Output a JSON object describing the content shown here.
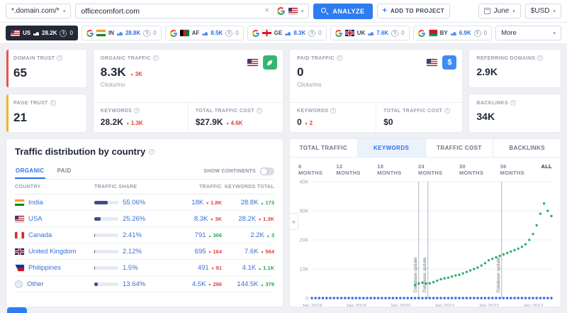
{
  "icons": {
    "chevron": "▾",
    "close": "×",
    "collapse": "«",
    "plus": "+",
    "dollar": "$"
  },
  "topbar": {
    "scope_select": "*.domain.com/*",
    "search_value": "officecomfort.com",
    "analyze_label": "ANALYZE",
    "add_to_project_label": "ADD TO PROJECT",
    "month_select": "June",
    "currency_select": "$USD"
  },
  "country_bar": {
    "more_label": "More",
    "tabs": [
      {
        "code": "US",
        "flag": "us",
        "traffic": "28.2K",
        "paid": "0",
        "active": true
      },
      {
        "code": "IN",
        "flag": "in",
        "traffic": "28.8K",
        "paid": "0",
        "active": false
      },
      {
        "code": "AF",
        "flag": "af",
        "traffic": "8.5K",
        "paid": "0",
        "active": false
      },
      {
        "code": "GE",
        "flag": "ge",
        "traffic": "8.3K",
        "paid": "0",
        "active": false
      },
      {
        "code": "UK",
        "flag": "gb",
        "traffic": "7.6K",
        "paid": "0",
        "active": false
      },
      {
        "code": "BY",
        "flag": "by",
        "traffic": "6.9K",
        "paid": "0",
        "active": false
      }
    ]
  },
  "summary": {
    "domain_trust": {
      "label": "DOMAIN TRUST",
      "value": "65"
    },
    "page_trust": {
      "label": "PAGE TRUST",
      "value": "21"
    },
    "organic": {
      "label": "ORGANIC TRAFFIC",
      "value": "8.3K",
      "delta": "3K",
      "delta_dir": "down",
      "unit": "Clicks/mo",
      "keywords_label": "KEYWORDS",
      "keywords_value": "28.2K",
      "keywords_delta": "1.3K",
      "keywords_delta_dir": "down",
      "cost_label": "TOTAL TRAFFIC COST",
      "cost_value": "$27.9K",
      "cost_delta": "4.6K",
      "cost_delta_dir": "down"
    },
    "paid": {
      "label": "PAID TRAFFIC",
      "value": "0",
      "unit": "Clicks/mo",
      "keywords_label": "KEYWORDS",
      "keywords_value": "0",
      "keywords_delta": "2",
      "keywords_delta_dir": "down",
      "cost_label": "TOTAL TRAFFIC COST",
      "cost_value": "$0"
    },
    "referring_domains": {
      "label": "REFERRING DOMAINS",
      "value": "2.9K"
    },
    "backlinks": {
      "label": "BACKLINKS",
      "value": "34K"
    }
  },
  "distribution": {
    "title": "Traffic distribution by country",
    "tab_organic": "ORGANIC",
    "tab_paid": "PAID",
    "show_continents": "SHOW CONTINENTS",
    "col_country": "COUNTRY",
    "col_share": "TRAFFIC SHARE",
    "col_traffic": "TRAFFIC",
    "col_keywords": "KEYWORDS TOTAL",
    "rows": [
      {
        "country": "India",
        "flag": "in",
        "share": "55.06%",
        "share_pct": 55.06,
        "traffic": "18K",
        "traffic_delta": "1.8K",
        "traffic_dir": "down",
        "keywords": "28.8K",
        "keywords_delta": "173",
        "keywords_dir": "up"
      },
      {
        "country": "USA",
        "flag": "us",
        "share": "25.26%",
        "share_pct": 25.26,
        "traffic": "8.3K",
        "traffic_delta": "3K",
        "traffic_dir": "down",
        "keywords": "28.2K",
        "keywords_delta": "1.3K",
        "keywords_dir": "down"
      },
      {
        "country": "Canada",
        "flag": "ca",
        "share": "2.41%",
        "share_pct": 2.41,
        "traffic": "791",
        "traffic_delta": "306",
        "traffic_dir": "up",
        "keywords": "2.2K",
        "keywords_delta": "3",
        "keywords_dir": "up"
      },
      {
        "country": "United Kingdom",
        "flag": "gb",
        "share": "2.12%",
        "share_pct": 2.12,
        "traffic": "695",
        "traffic_delta": "164",
        "traffic_dir": "down",
        "keywords": "7.6K",
        "keywords_delta": "564",
        "keywords_dir": "down"
      },
      {
        "country": "Philippines",
        "flag": "ph",
        "share": "1.5%",
        "share_pct": 1.5,
        "traffic": "491",
        "traffic_delta": "91",
        "traffic_dir": "down",
        "keywords": "4.1K",
        "keywords_delta": "1.1K",
        "keywords_dir": "up"
      },
      {
        "country": "Other",
        "flag": "globe",
        "share": "13.64%",
        "share_pct": 13.64,
        "traffic": "4.5K",
        "traffic_delta": "296",
        "traffic_dir": "down",
        "keywords": "144.5K",
        "keywords_delta": "379",
        "keywords_dir": "up"
      }
    ]
  },
  "chart_panel": {
    "tabs": [
      "TOTAL TRAFFIC",
      "KEYWORDS",
      "TRAFFIC COST",
      "BACKLINKS"
    ],
    "active_tab": "KEYWORDS",
    "ranges": [
      "6 MONTHS",
      "12 MONTHS",
      "18 MONTHS",
      "24 MONTHS",
      "30 MONTHS",
      "36 MONTHS",
      "ALL"
    ],
    "active_range": "ALL"
  },
  "chart_data": {
    "type": "scatter",
    "title": "Keywords",
    "xlabel": "",
    "ylabel": "",
    "ylim": [
      0,
      40000
    ],
    "months_total": 66,
    "grid": true,
    "y_ticks": [
      {
        "v": 0,
        "label": "0"
      },
      {
        "v": 10000,
        "label": "10K"
      },
      {
        "v": 20000,
        "label": "20K"
      },
      {
        "v": 30000,
        "label": "30K"
      },
      {
        "v": 40000,
        "label": "40K"
      }
    ],
    "x_ticks": [
      {
        "m": 0,
        "label": "Jan 2018"
      },
      {
        "m": 12,
        "label": "Jan 2019"
      },
      {
        "m": 24,
        "label": "Jan 2020"
      },
      {
        "m": 36,
        "label": "Jan 2021"
      },
      {
        "m": 48,
        "label": "Jan 2022"
      },
      {
        "m": 60,
        "label": "Jan 2023"
      }
    ],
    "annotations": [
      {
        "label": "Database update",
        "month": 29
      },
      {
        "label": "Database update",
        "month": 31.5
      },
      {
        "label": "Database update",
        "month": 51.5
      }
    ],
    "series": [
      {
        "name": "organic keywords",
        "color": "#2fae6d",
        "points": [
          [
            28,
            4500
          ],
          [
            29,
            5000
          ],
          [
            30,
            5300
          ],
          [
            31,
            5000
          ],
          [
            32,
            5100
          ],
          [
            33,
            5500
          ],
          [
            34,
            6000
          ],
          [
            35,
            6500
          ],
          [
            36,
            6800
          ],
          [
            37,
            7000
          ],
          [
            38,
            7400
          ],
          [
            39,
            7800
          ],
          [
            40,
            8000
          ],
          [
            41,
            8500
          ],
          [
            42,
            9000
          ],
          [
            43,
            9500
          ],
          [
            44,
            10000
          ],
          [
            45,
            10500
          ],
          [
            46,
            11200
          ],
          [
            47,
            12000
          ],
          [
            48,
            13000
          ],
          [
            49,
            13500
          ],
          [
            50,
            14000
          ],
          [
            51,
            14500
          ],
          [
            52,
            15000
          ],
          [
            53,
            15500
          ],
          [
            54,
            16000
          ],
          [
            55,
            16500
          ],
          [
            56,
            17000
          ],
          [
            57,
            17600
          ],
          [
            58,
            18500
          ],
          [
            59,
            20000
          ],
          [
            60,
            22000
          ],
          [
            61,
            25000
          ],
          [
            62,
            29000
          ],
          [
            63,
            32500
          ],
          [
            64,
            30000
          ],
          [
            65,
            28200
          ]
        ]
      },
      {
        "name": "paid keywords",
        "color": "#3f6ad8",
        "constant_value": 0,
        "month_from": 0,
        "month_to": 65
      }
    ]
  }
}
